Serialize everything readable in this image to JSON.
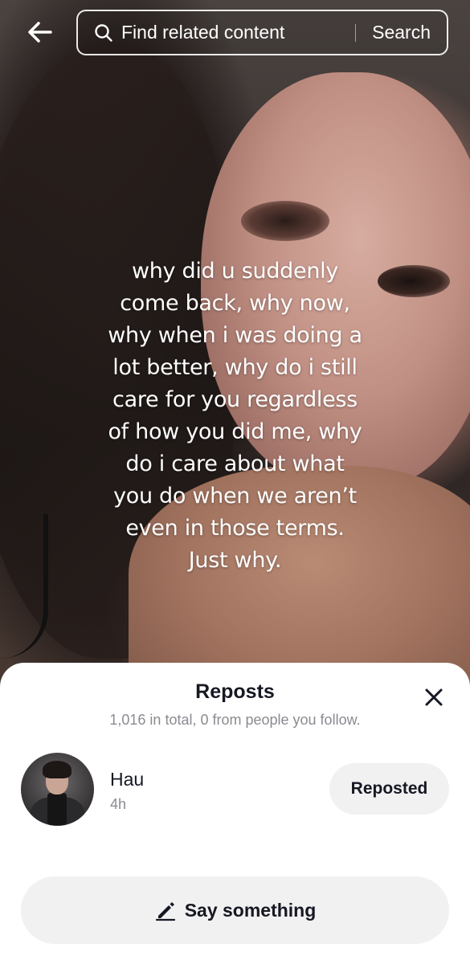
{
  "header": {
    "back_icon": "arrow-left-icon",
    "search_icon": "search-icon",
    "search_placeholder": "Find related content",
    "search_button": "Search"
  },
  "video": {
    "overlay_text_lines": [
      "why did u suddenly",
      "come back, why now,",
      "why when i was doing a",
      "lot better, why do i still",
      "care for you regardless",
      "of how you did me, why",
      "do i care about what",
      "you do when we aren’t",
      "even in those terms.",
      "Just why."
    ]
  },
  "sheet": {
    "title": "Reposts",
    "subtitle": "1,016 in total, 0 from people you follow.",
    "close_icon": "close-icon",
    "reposts": [
      {
        "name": "Hau",
        "time": "4h",
        "action_label": "Reposted"
      }
    ],
    "say_something": {
      "icon": "pencil-icon",
      "label": "Say something"
    }
  }
}
